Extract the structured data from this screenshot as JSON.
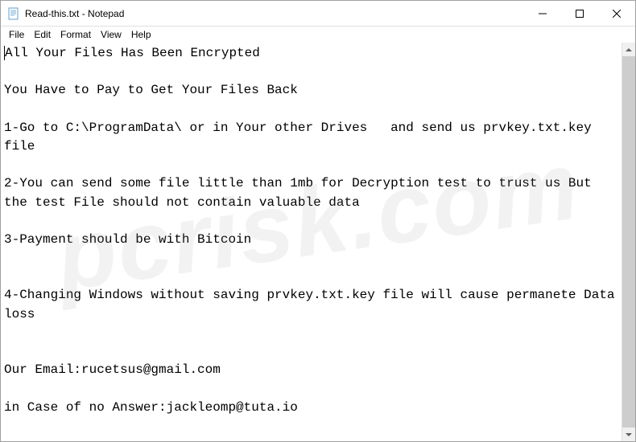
{
  "window": {
    "title": "Read-this.txt - Notepad"
  },
  "menu": {
    "file": "File",
    "edit": "Edit",
    "format": "Format",
    "view": "View",
    "help": "Help"
  },
  "document": {
    "line1": "All Your Files Has Been Encrypted",
    "line2": "",
    "line3": "You Have to Pay to Get Your Files Back",
    "line4": "",
    "line5": "1-Go to C:\\ProgramData\\ or in Your other Drives   and send us prvkey.txt.key  file",
    "line6": "",
    "line7": "2-You can send some file little than 1mb for Decryption test to trust us But the test File should not contain valuable data",
    "line8": "",
    "line9": "3-Payment should be with Bitcoin",
    "line10": "",
    "line11": "",
    "line12": "4-Changing Windows without saving prvkey.txt.key file will cause permanete Data loss",
    "line13": "",
    "line14": "",
    "line15": "Our Email:rucetsus@gmail.com",
    "line16": "",
    "line17": "in Case of no Answer:jackleomp@tuta.io"
  },
  "watermark": "pcrisk.com"
}
